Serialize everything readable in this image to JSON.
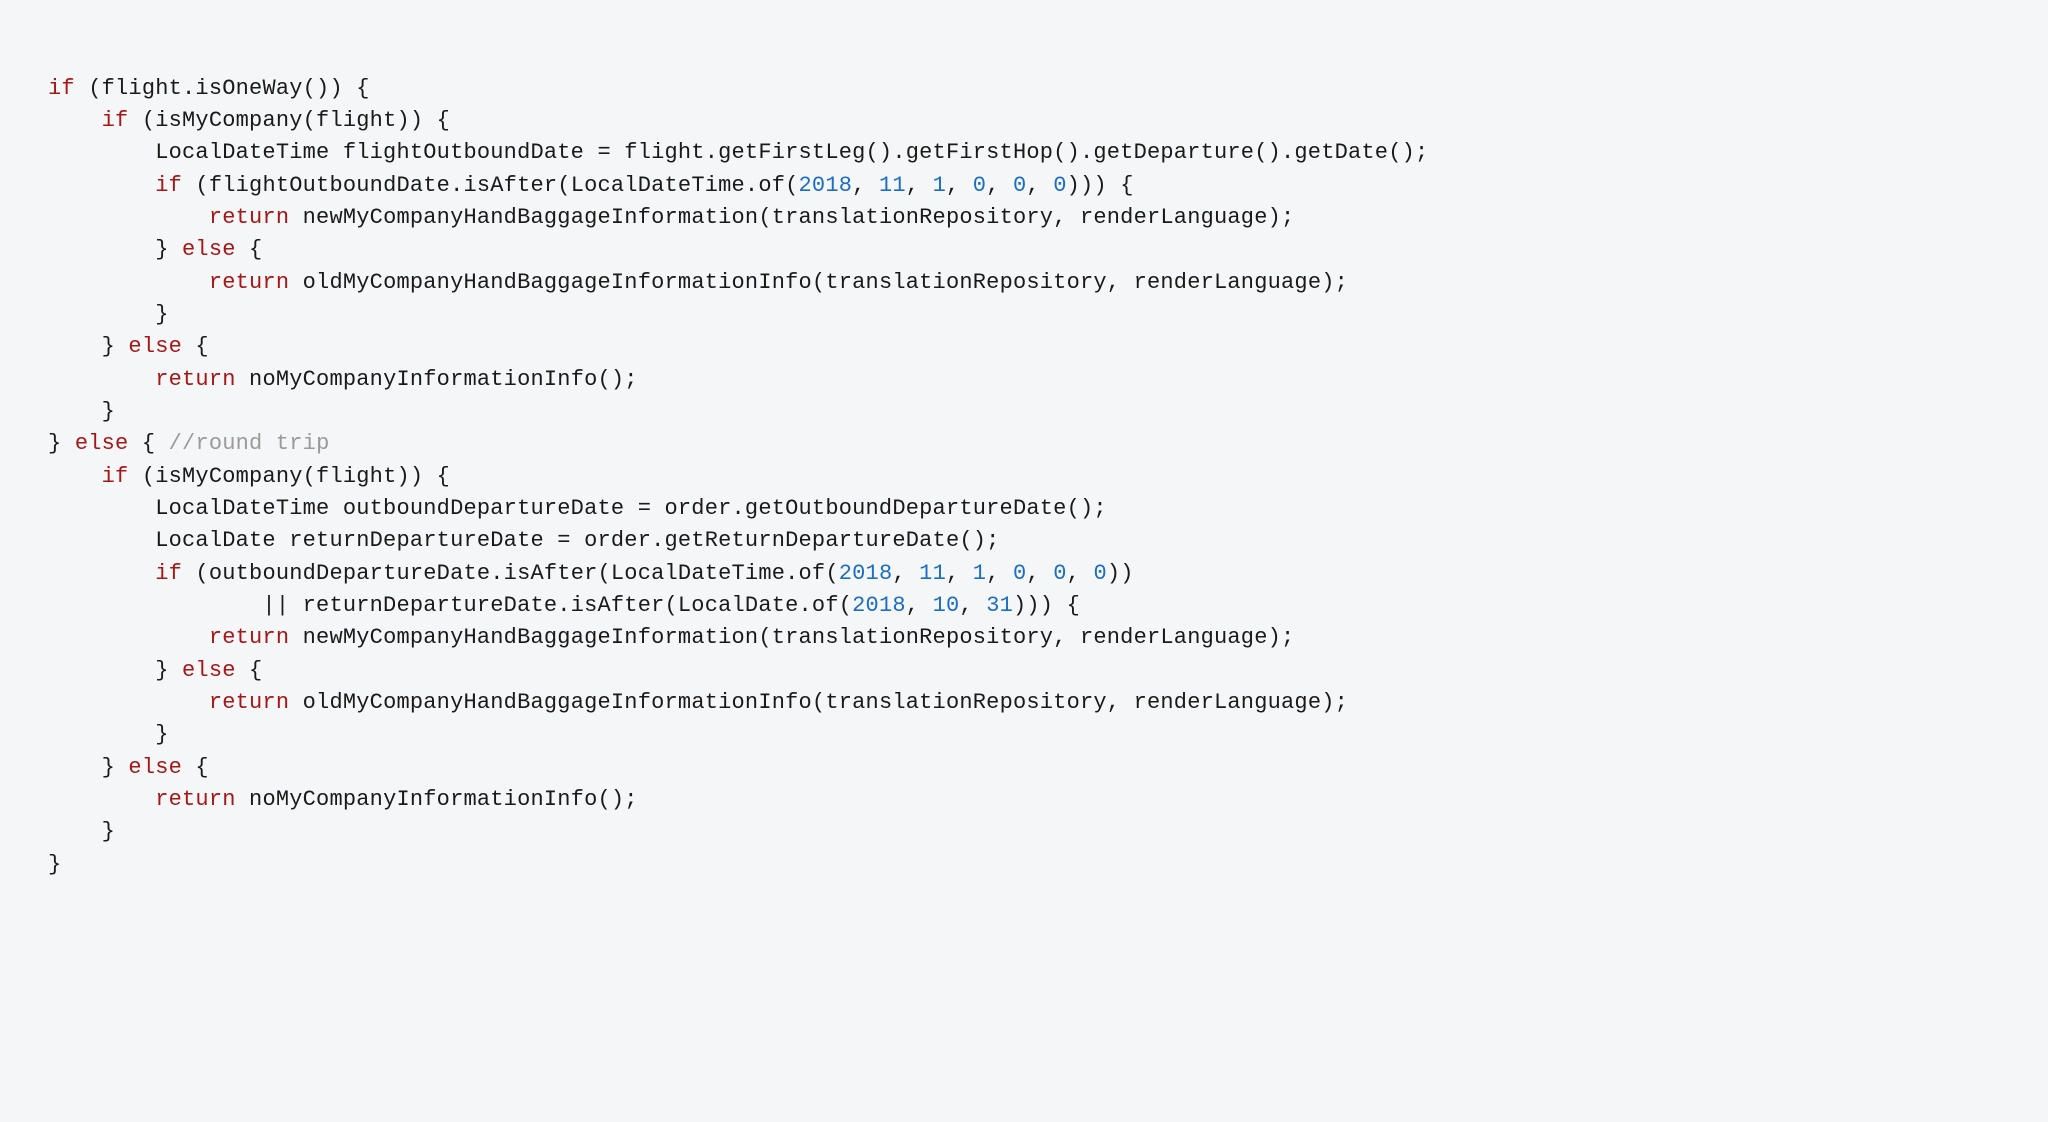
{
  "code": {
    "tokens": [
      [
        "kw",
        "if"
      ],
      [
        "txt",
        " (flight.isOneWay()) {\n"
      ],
      [
        "txt",
        "    "
      ],
      [
        "kw",
        "if"
      ],
      [
        "txt",
        " (isMyCompany(flight)) {\n"
      ],
      [
        "txt",
        "        LocalDateTime flightOutboundDate = flight.getFirstLeg().getFirstHop().getDeparture().getDate();\n"
      ],
      [
        "txt",
        "        "
      ],
      [
        "kw",
        "if"
      ],
      [
        "txt",
        " (flightOutboundDate.isAfter(LocalDateTime.of("
      ],
      [
        "num",
        "2018"
      ],
      [
        "txt",
        ", "
      ],
      [
        "num",
        "11"
      ],
      [
        "txt",
        ", "
      ],
      [
        "num",
        "1"
      ],
      [
        "txt",
        ", "
      ],
      [
        "num",
        "0"
      ],
      [
        "txt",
        ", "
      ],
      [
        "num",
        "0"
      ],
      [
        "txt",
        ", "
      ],
      [
        "num",
        "0"
      ],
      [
        "txt",
        "))) {\n"
      ],
      [
        "txt",
        "            "
      ],
      [
        "kw",
        "return"
      ],
      [
        "txt",
        " newMyCompanyHandBaggageInformation(translationRepository, renderLanguage);\n"
      ],
      [
        "txt",
        "        } "
      ],
      [
        "kw",
        "else"
      ],
      [
        "txt",
        " {\n"
      ],
      [
        "txt",
        "            "
      ],
      [
        "kw",
        "return"
      ],
      [
        "txt",
        " oldMyCompanyHandBaggageInformationInfo(translationRepository, renderLanguage);\n"
      ],
      [
        "txt",
        "        }\n"
      ],
      [
        "txt",
        "    } "
      ],
      [
        "kw",
        "else"
      ],
      [
        "txt",
        " {\n"
      ],
      [
        "txt",
        "        "
      ],
      [
        "kw",
        "return"
      ],
      [
        "txt",
        " noMyCompanyInformationInfo();\n"
      ],
      [
        "txt",
        "    }\n"
      ],
      [
        "txt",
        "} "
      ],
      [
        "kw",
        "else"
      ],
      [
        "txt",
        " { "
      ],
      [
        "cmt",
        "//round trip\n"
      ],
      [
        "txt",
        "    "
      ],
      [
        "kw",
        "if"
      ],
      [
        "txt",
        " (isMyCompany(flight)) {\n"
      ],
      [
        "txt",
        "        LocalDateTime outboundDepartureDate = order.getOutboundDepartureDate();\n"
      ],
      [
        "txt",
        "        LocalDate returnDepartureDate = order.getReturnDepartureDate();\n"
      ],
      [
        "txt",
        "        "
      ],
      [
        "kw",
        "if"
      ],
      [
        "txt",
        " (outboundDepartureDate.isAfter(LocalDateTime.of("
      ],
      [
        "num",
        "2018"
      ],
      [
        "txt",
        ", "
      ],
      [
        "num",
        "11"
      ],
      [
        "txt",
        ", "
      ],
      [
        "num",
        "1"
      ],
      [
        "txt",
        ", "
      ],
      [
        "num",
        "0"
      ],
      [
        "txt",
        ", "
      ],
      [
        "num",
        "0"
      ],
      [
        "txt",
        ", "
      ],
      [
        "num",
        "0"
      ],
      [
        "txt",
        "))\n"
      ],
      [
        "txt",
        "                || returnDepartureDate.isAfter(LocalDate.of("
      ],
      [
        "num",
        "2018"
      ],
      [
        "txt",
        ", "
      ],
      [
        "num",
        "10"
      ],
      [
        "txt",
        ", "
      ],
      [
        "num",
        "31"
      ],
      [
        "txt",
        "))) {\n"
      ],
      [
        "txt",
        "            "
      ],
      [
        "kw",
        "return"
      ],
      [
        "txt",
        " newMyCompanyHandBaggageInformation(translationRepository, renderLanguage);\n"
      ],
      [
        "txt",
        "        } "
      ],
      [
        "kw",
        "else"
      ],
      [
        "txt",
        " {\n"
      ],
      [
        "txt",
        "            "
      ],
      [
        "kw",
        "return"
      ],
      [
        "txt",
        " oldMyCompanyHandBaggageInformationInfo(translationRepository, renderLanguage);\n"
      ],
      [
        "txt",
        "        }\n"
      ],
      [
        "txt",
        "    } "
      ],
      [
        "kw",
        "else"
      ],
      [
        "txt",
        " {\n"
      ],
      [
        "txt",
        "        "
      ],
      [
        "kw",
        "return"
      ],
      [
        "txt",
        " noMyCompanyInformationInfo();\n"
      ],
      [
        "txt",
        "    }\n"
      ],
      [
        "txt",
        "}"
      ]
    ]
  }
}
